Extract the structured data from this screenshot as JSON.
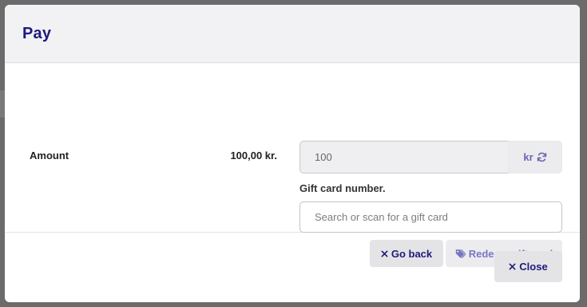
{
  "modal": {
    "title": "Pay"
  },
  "amount": {
    "label": "Amount",
    "value": "100,00 kr.",
    "input_value": "100",
    "currency_label": "kr"
  },
  "gift_card": {
    "label": "Gift card number.",
    "placeholder": "Search or scan for a gift card",
    "value": ""
  },
  "actions": {
    "go_back_label": "Go back",
    "redeem_label": "Redeem gift card",
    "close_label": "Close"
  },
  "icons": {
    "refresh": "refresh-icon",
    "tag": "tag-icon",
    "close": "close-icon"
  },
  "colors": {
    "primary": "#1e1a7a",
    "accent_muted": "#7b75c4",
    "header_bg": "#f2f2f4"
  }
}
